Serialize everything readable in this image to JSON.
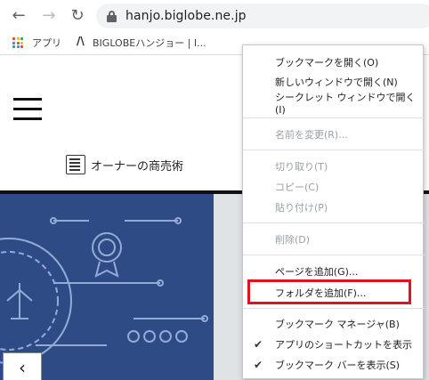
{
  "toolbar": {
    "back_icon": "arrow-left-icon",
    "forward_icon": "arrow-right-icon",
    "reload_icon": "reload-icon",
    "url": "hanjo.biglobe.ne.jp"
  },
  "bookmarks": {
    "apps_label": "アプリ",
    "biglobe_label": "BIGLOBEハンジョー | I..."
  },
  "page": {
    "nav_owner_label": "オーナーの商売術"
  },
  "context_menu": {
    "items": [
      {
        "label": "ブックマークを開く(O)",
        "disabled": false
      },
      {
        "label": "新しいウィンドウで開く(N)",
        "disabled": false
      },
      {
        "label": "シークレット ウィンドウで開く(I)",
        "disabled": false
      },
      {
        "label": "名前を変更(R)...",
        "disabled": true
      },
      {
        "label": "切り取り(T)",
        "disabled": true
      },
      {
        "label": "コピー(C)",
        "disabled": true
      },
      {
        "label": "貼り付け(P)",
        "disabled": true
      },
      {
        "label": "削除(D)",
        "disabled": true
      },
      {
        "label": "ページを追加(G)...",
        "disabled": false
      },
      {
        "label": "フォルダを追加(F)...",
        "disabled": false
      },
      {
        "label": "ブックマーク マネージャ(B)",
        "disabled": false
      },
      {
        "label": "アプリのショートカットを表示",
        "disabled": false,
        "checked": true
      },
      {
        "label": "ブックマーク バーを表示(S)",
        "disabled": false,
        "checked": true
      }
    ]
  },
  "colors": {
    "highlight": "#e0141e",
    "hero_bg": "#2f4b85"
  }
}
